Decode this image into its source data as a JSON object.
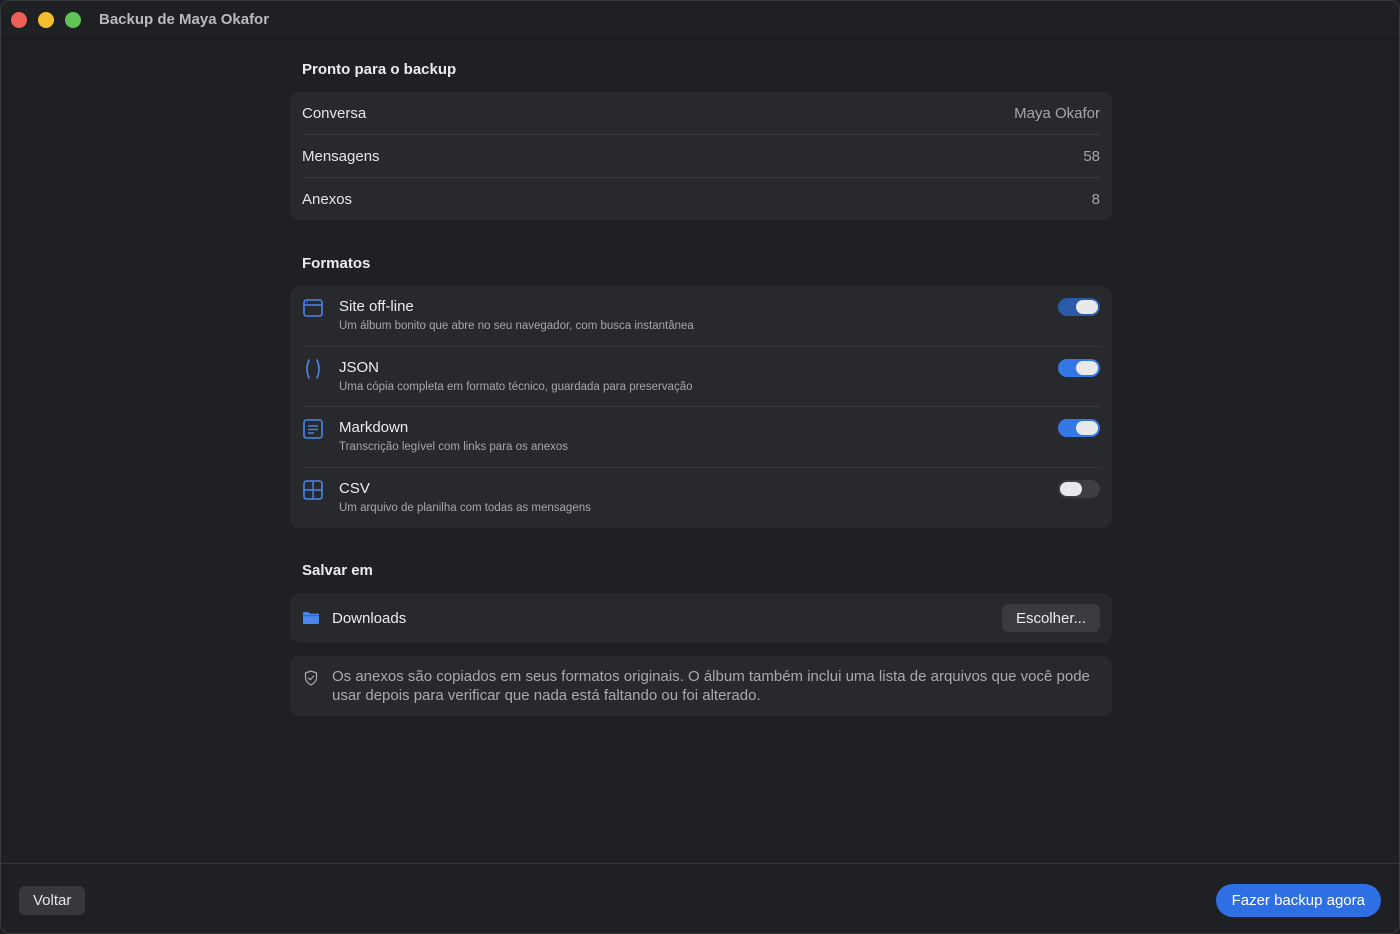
{
  "window": {
    "title": "Backup de Maya Okafor"
  },
  "summary": {
    "heading": "Pronto para o backup",
    "rows": [
      {
        "label": "Conversa",
        "value": "Maya Okafor"
      },
      {
        "label": "Mensagens",
        "value": "58"
      },
      {
        "label": "Anexos",
        "value": "8"
      }
    ]
  },
  "formats": {
    "heading": "Formatos",
    "items": [
      {
        "icon": "browser-window-icon",
        "name": "Site off-line",
        "description": "Um álbum bonito que abre no seu navegador, com busca instantânea",
        "enabled": true
      },
      {
        "icon": "braces-icon",
        "name": "JSON",
        "description": "Uma cópia completa em formato técnico, guardada para preservação",
        "enabled": true
      },
      {
        "icon": "document-text-icon",
        "name": "Markdown",
        "description": "Transcrição legível com links para os anexos",
        "enabled": true
      },
      {
        "icon": "table-grid-icon",
        "name": "CSV",
        "description": "Um arquivo de planilha com todas as mensagens",
        "enabled": false
      }
    ]
  },
  "save": {
    "heading": "Salvar em",
    "location": "Downloads",
    "choose_label": "Escolher..."
  },
  "note": {
    "text": "Os anexos são copiados em seus formatos originais. O álbum também inclui uma lista de arquivos que você pode usar depois para verificar que nada está faltando ou foi alterado."
  },
  "footer": {
    "back_label": "Voltar",
    "primary_label": "Fazer backup agora"
  },
  "colors": {
    "accent": "#2f6fe4",
    "icon_blue": "#4a86ec",
    "background": "#1f2023",
    "card": "#28292c"
  }
}
